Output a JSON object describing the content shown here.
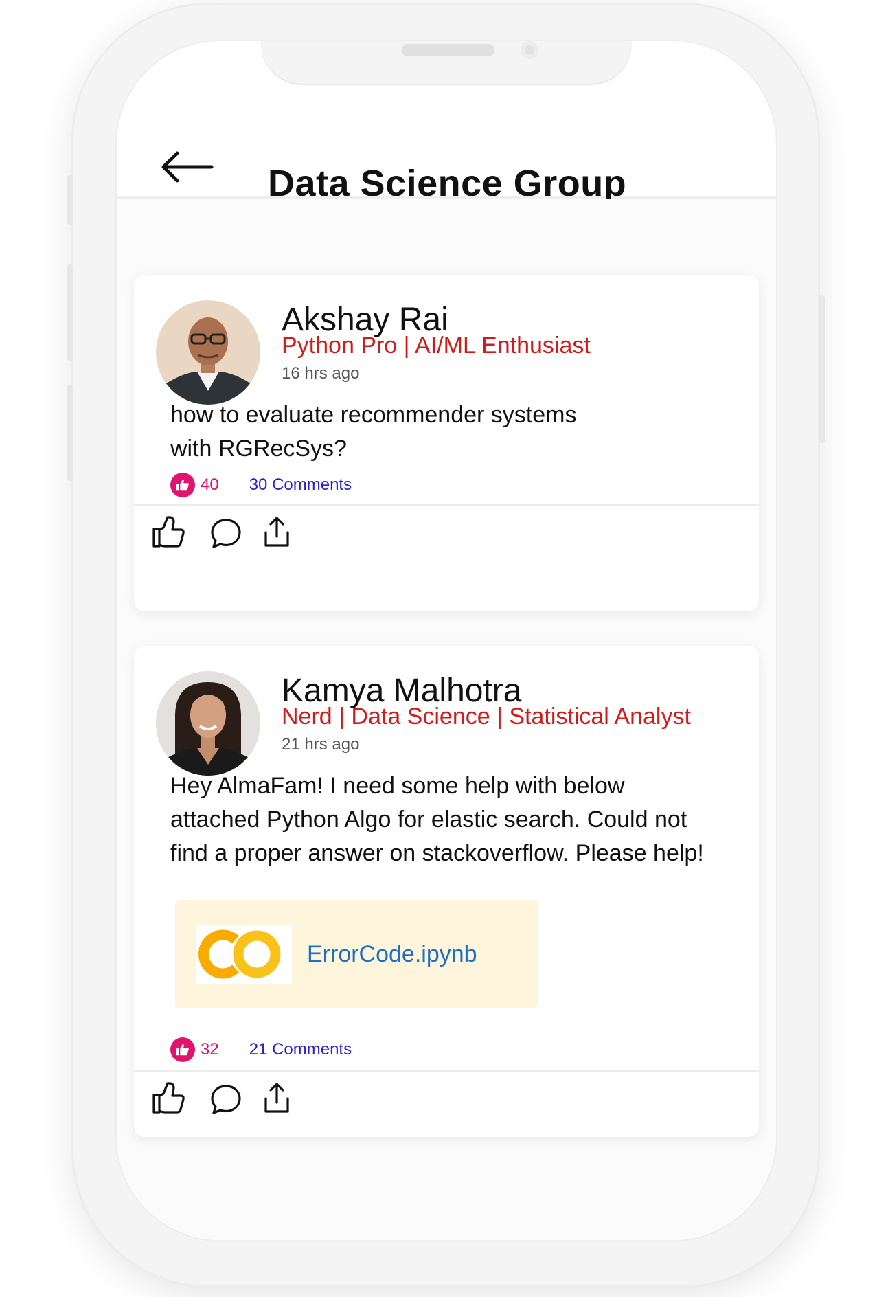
{
  "header": {
    "title": "Data Science Group",
    "back_icon": "arrow-left-icon"
  },
  "posts": [
    {
      "author_name": "Akshay Rai",
      "author_title": "Python Pro | AI/ML Enthusiast",
      "time": "16 hrs ago",
      "body": "how to evaluate recommender systems with RGRecSys?",
      "likes": "40",
      "comments": "30 Comments"
    },
    {
      "author_name": "Kamya Malhotra",
      "author_title": "Nerd | Data Science | Statistical Analyst",
      "time": "21 hrs ago",
      "body": "Hey AlmaFam! I need some help with below attached Python Algo for elastic search. Could not find a proper answer on stackoverflow. Please help!",
      "attachment": {
        "file_name": "ErrorCode.ipynb",
        "icon": "colab-logo-icon"
      },
      "likes": "32",
      "comments": "21 Comments"
    }
  ],
  "actions": {
    "like_icon": "thumbs-up-icon",
    "comment_icon": "comment-bubble-icon",
    "share_icon": "share-icon"
  },
  "colors": {
    "accent_red": "#d11a1a",
    "like_pink": "#e2136e",
    "comment_blue": "#2a1fd0",
    "link_blue": "#1d6fc4",
    "attachment_bg": "#fef5dc"
  }
}
